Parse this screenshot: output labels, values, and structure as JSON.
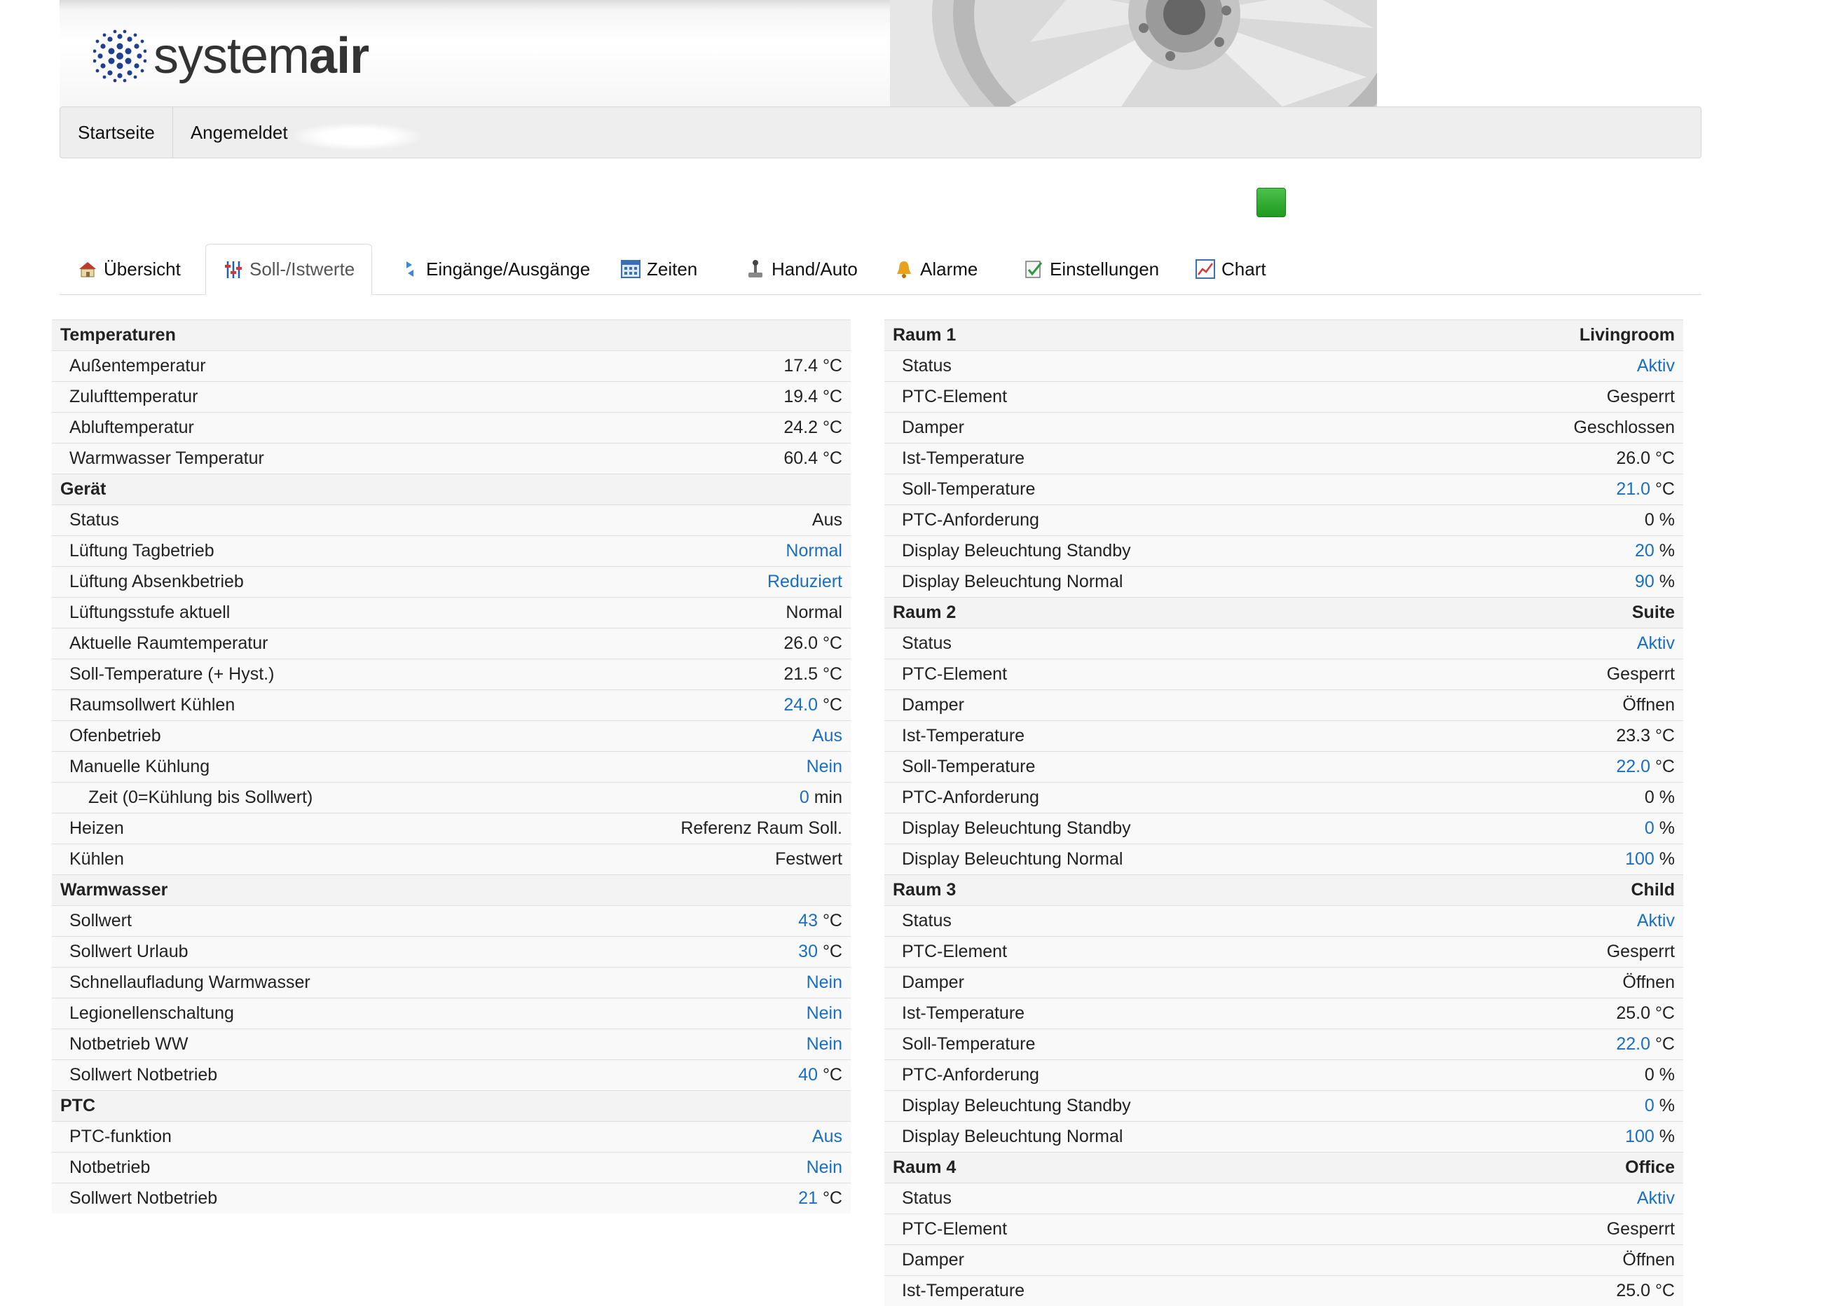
{
  "header": {
    "logo_text_regular": "system",
    "logo_text_bold": "air"
  },
  "nav": {
    "home": "Startseite",
    "logged_in": "Angemeldet"
  },
  "tabs": [
    {
      "label": "Übersicht",
      "icon": "house-icon"
    },
    {
      "label": "Soll-/Istwerte",
      "icon": "sliders-icon"
    },
    {
      "label": "Eingänge/Ausgänge",
      "icon": "io-arrows-icon"
    },
    {
      "label": "Zeiten",
      "icon": "calendar-icon"
    },
    {
      "label": "Hand/Auto",
      "icon": "joystick-icon"
    },
    {
      "label": "Alarme",
      "icon": "bell-icon"
    },
    {
      "label": "Einstellungen",
      "icon": "checklist-icon"
    },
    {
      "label": "Chart",
      "icon": "line-chart-icon"
    }
  ],
  "colors": {
    "link": "#1a6fc2",
    "status_ok": "#2eaa2e"
  },
  "left_rows": [
    {
      "type": "hdr",
      "label": "Temperaturen",
      "value": ""
    },
    {
      "type": "item",
      "label": "Außentemperatur",
      "value": "17.4",
      "unit": "°C"
    },
    {
      "type": "item",
      "label": "Zulufttemperatur",
      "value": "19.4",
      "unit": "°C"
    },
    {
      "type": "item",
      "label": "Abluftemperatur",
      "value": "24.2",
      "unit": "°C"
    },
    {
      "type": "item",
      "label": "Warmwasser Temperatur",
      "value": "60.4",
      "unit": "°C"
    },
    {
      "type": "hdr",
      "label": "Gerät",
      "value": ""
    },
    {
      "type": "item",
      "label": "Status",
      "value": "Aus",
      "unit": ""
    },
    {
      "type": "item",
      "label": "Lüftung Tagbetrieb",
      "value": "Normal",
      "unit": "",
      "link": true
    },
    {
      "type": "item",
      "label": "Lüftung Absenkbetrieb",
      "value": "Reduziert",
      "unit": "",
      "link": true
    },
    {
      "type": "item",
      "label": "Lüftungsstufe aktuell",
      "value": "Normal",
      "unit": ""
    },
    {
      "type": "item",
      "label": "Aktuelle Raumtemperatur",
      "value": "26.0",
      "unit": "°C"
    },
    {
      "type": "item",
      "label": "Soll-Temperature (+ Hyst.)",
      "value": "21.5",
      "unit": "°C"
    },
    {
      "type": "item",
      "label": "Raumsollwert Kühlen",
      "value": "24.0",
      "unit": "°C",
      "link": true
    },
    {
      "type": "item",
      "label": "Ofenbetrieb",
      "value": "Aus",
      "unit": "",
      "link": true
    },
    {
      "type": "item",
      "label": "Manuelle Kühlung",
      "value": "Nein",
      "unit": "",
      "link": true
    },
    {
      "type": "sub",
      "label": "Zeit (0=Kühlung bis Sollwert)",
      "value": "0",
      "unit": "min",
      "link": true
    },
    {
      "type": "item",
      "label": "Heizen",
      "value": "Referenz Raum Soll.",
      "unit": ""
    },
    {
      "type": "item",
      "label": "Kühlen",
      "value": "Festwert",
      "unit": ""
    },
    {
      "type": "hdr",
      "label": "Warmwasser",
      "value": ""
    },
    {
      "type": "item",
      "label": "Sollwert",
      "value": "43",
      "unit": "°C",
      "link": true
    },
    {
      "type": "item",
      "label": "Sollwert Urlaub",
      "value": "30",
      "unit": "°C",
      "link": true
    },
    {
      "type": "item",
      "label": "Schnellaufladung Warmwasser",
      "value": "Nein",
      "unit": "",
      "link": true
    },
    {
      "type": "item",
      "label": "Legionellenschaltung",
      "value": "Nein",
      "unit": "",
      "link": true
    },
    {
      "type": "item",
      "label": "Notbetrieb WW",
      "value": "Nein",
      "unit": "",
      "link": true
    },
    {
      "type": "item",
      "label": "Sollwert Notbetrieb",
      "value": "40",
      "unit": "°C",
      "link": true
    },
    {
      "type": "hdr",
      "label": "PTC",
      "value": ""
    },
    {
      "type": "item",
      "label": "PTC-funktion",
      "value": "Aus",
      "unit": "",
      "link": true
    },
    {
      "type": "item",
      "label": "Notbetrieb",
      "value": "Nein",
      "unit": "",
      "link": true
    },
    {
      "type": "item",
      "label": "Sollwert Notbetrieb",
      "value": "21",
      "unit": "°C",
      "link": true
    }
  ],
  "right_rows": [
    {
      "type": "hdr",
      "label": "Raum 1",
      "value": "Livingroom"
    },
    {
      "type": "item",
      "label": "Status",
      "value": "Aktiv",
      "unit": "",
      "link": true
    },
    {
      "type": "item",
      "label": "PTC-Element",
      "value": "Gesperrt",
      "unit": ""
    },
    {
      "type": "item",
      "label": "Damper",
      "value": "Geschlossen",
      "unit": ""
    },
    {
      "type": "item",
      "label": "Ist-Temperature",
      "value": "26.0",
      "unit": "°C"
    },
    {
      "type": "item",
      "label": "Soll-Temperature",
      "value": "21.0",
      "unit": "°C",
      "link": true
    },
    {
      "type": "item",
      "label": "PTC-Anforderung",
      "value": "0",
      "unit": "%"
    },
    {
      "type": "item",
      "label": "Display Beleuchtung Standby",
      "value": "20",
      "unit": "%",
      "link": true
    },
    {
      "type": "item",
      "label": "Display Beleuchtung Normal",
      "value": "90",
      "unit": "%",
      "link": true
    },
    {
      "type": "hdr",
      "label": "Raum 2",
      "value": "Suite"
    },
    {
      "type": "item",
      "label": "Status",
      "value": "Aktiv",
      "unit": "",
      "link": true
    },
    {
      "type": "item",
      "label": "PTC-Element",
      "value": "Gesperrt",
      "unit": ""
    },
    {
      "type": "item",
      "label": "Damper",
      "value": "Öffnen",
      "unit": ""
    },
    {
      "type": "item",
      "label": "Ist-Temperature",
      "value": "23.3",
      "unit": "°C"
    },
    {
      "type": "item",
      "label": "Soll-Temperature",
      "value": "22.0",
      "unit": "°C",
      "link": true
    },
    {
      "type": "item",
      "label": "PTC-Anforderung",
      "value": "0",
      "unit": "%"
    },
    {
      "type": "item",
      "label": "Display Beleuchtung Standby",
      "value": "0",
      "unit": "%",
      "link": true
    },
    {
      "type": "item",
      "label": "Display Beleuchtung Normal",
      "value": "100",
      "unit": "%",
      "link": true
    },
    {
      "type": "hdr",
      "label": "Raum 3",
      "value": "Child"
    },
    {
      "type": "item",
      "label": "Status",
      "value": "Aktiv",
      "unit": "",
      "link": true
    },
    {
      "type": "item",
      "label": "PTC-Element",
      "value": "Gesperrt",
      "unit": ""
    },
    {
      "type": "item",
      "label": "Damper",
      "value": "Öffnen",
      "unit": ""
    },
    {
      "type": "item",
      "label": "Ist-Temperature",
      "value": "25.0",
      "unit": "°C"
    },
    {
      "type": "item",
      "label": "Soll-Temperature",
      "value": "22.0",
      "unit": "°C",
      "link": true
    },
    {
      "type": "item",
      "label": "PTC-Anforderung",
      "value": "0",
      "unit": "%"
    },
    {
      "type": "item",
      "label": "Display Beleuchtung Standby",
      "value": "0",
      "unit": "%",
      "link": true
    },
    {
      "type": "item",
      "label": "Display Beleuchtung Normal",
      "value": "100",
      "unit": "%",
      "link": true
    },
    {
      "type": "hdr",
      "label": "Raum 4",
      "value": "Office"
    },
    {
      "type": "item",
      "label": "Status",
      "value": "Aktiv",
      "unit": "",
      "link": true
    },
    {
      "type": "item",
      "label": "PTC-Element",
      "value": "Gesperrt",
      "unit": ""
    },
    {
      "type": "item",
      "label": "Damper",
      "value": "Öffnen",
      "unit": ""
    },
    {
      "type": "item",
      "label": "Ist-Temperature",
      "value": "25.0",
      "unit": "°C"
    }
  ]
}
